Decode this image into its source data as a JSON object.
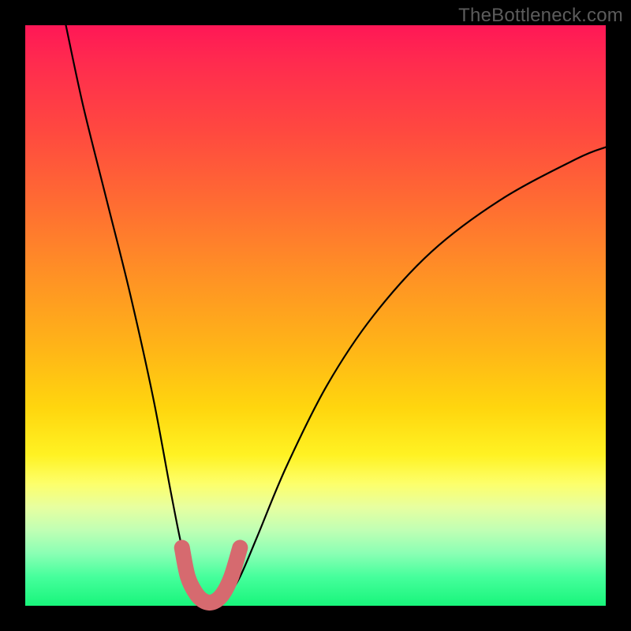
{
  "watermark": "TheBottleneck.com",
  "chart_data": {
    "type": "line",
    "title": "",
    "xlabel": "",
    "ylabel": "",
    "xlim": [
      0,
      100
    ],
    "ylim": [
      0,
      100
    ],
    "series": [
      {
        "name": "bottleneck-curve",
        "x": [
          7,
          10,
          14,
          18,
          22,
          25,
          27,
          28.5,
          30,
          31.5,
          33,
          35,
          37,
          40,
          45,
          52,
          60,
          70,
          82,
          95,
          100
        ],
        "values": [
          100,
          86,
          70,
          54,
          36,
          20,
          10,
          5,
          2,
          0.5,
          0.5,
          2,
          5,
          12,
          24,
          38,
          50,
          61,
          70,
          77,
          79
        ]
      }
    ],
    "markers": {
      "name": "highlight-segment",
      "color": "#d66a6f",
      "x": [
        27.0,
        28.0,
        29.5,
        31.0,
        32.5,
        34.0,
        35.5,
        37.0
      ],
      "values": [
        10.0,
        5.0,
        2.0,
        0.7,
        0.7,
        2.0,
        5.0,
        10.0
      ]
    }
  },
  "colors": {
    "curve": "#000000",
    "marker": "#d66a6f",
    "marker_edge": "#bb4a50"
  }
}
